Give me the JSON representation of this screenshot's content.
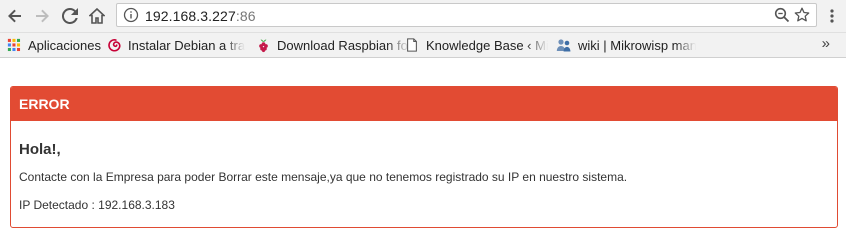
{
  "browser": {
    "url_host": "192.168.3.227",
    "url_port": ":86"
  },
  "bookmarks": {
    "items": [
      {
        "label": "Aplicaciones",
        "icon": "apps-grid-icon"
      },
      {
        "label": "Instalar Debian a través",
        "icon": "debian-icon"
      },
      {
        "label": "Download Raspbian for",
        "icon": "raspberry-icon"
      },
      {
        "label": "Knowledge Base ‹ Mikrowisp",
        "icon": "page-icon"
      },
      {
        "label": "wiki | Mikrowisp manual",
        "icon": "users-icon"
      }
    ],
    "more": "»"
  },
  "panel": {
    "heading": "ERROR",
    "greeting": "Hola!,",
    "message": "Contacte con la Empresa para poder Borrar este mensaje,ya que no tenemos registrado su IP en nuestro sistema.",
    "ip_line": "IP Detectado : 192.168.3.183"
  },
  "colors": {
    "error_red": "#e24b33",
    "toolbar_bg": "#f2f2f2"
  }
}
